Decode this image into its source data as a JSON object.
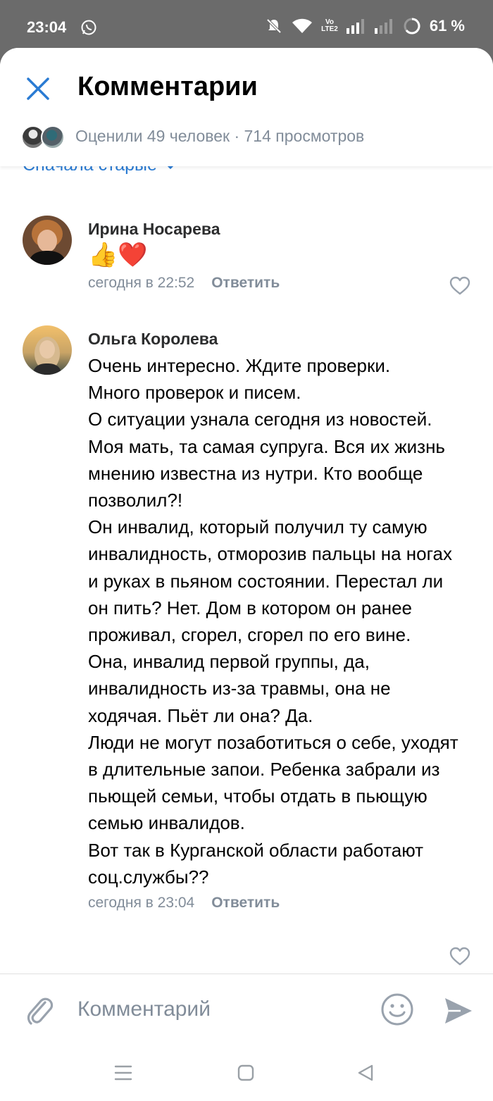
{
  "status_bar": {
    "time": "23:04",
    "battery": "61 %",
    "lte_top": "Vo",
    "lte_bottom": "LTE2"
  },
  "header": {
    "title": "Комментарии",
    "stats": "Оценили 49 человек · 714 просмотров"
  },
  "sort": {
    "label": "Сначала старые"
  },
  "comments": [
    {
      "author": "Ирина Носарева",
      "text": "👍❤️",
      "date": "сегодня в 22:52",
      "reply_label": "Ответить"
    },
    {
      "author": "Ольга Королева",
      "text": "Очень интересно. Ждите проверки.\nМного проверок и писем.\nО ситуации узнала сегодня из новостей.\nМоя мать, та самая супруга. Вся их жизнь мнению известна из нутри. Кто вообще позволил?!\nОн инвалид, который получил ту самую инвалидность, отморозив пальцы на ногах и руках в пьяном состоянии. Перестал ли он пить? Нет. Дом в котором он ранее проживал, сгорел, сгорел по его вине.\nОна, инвалид первой группы, да, инвалидность из-за травмы, она не ходячая. Пьёт ли она? Да.\nЛюди не могут позаботиться о себе, уходят в длительные запои. Ребенка забрали из пьющей семьи, чтобы отдать в пьющую семью инвалидов.\nВот так в Курганской области работают соц.службы??",
      "date": "сегодня в 23:04",
      "reply_label": "Ответить"
    }
  ],
  "composer": {
    "placeholder": "Комментарий"
  },
  "colors": {
    "accent": "#2a7bd3",
    "secondary_text": "#818c99",
    "heart": "#e0213b"
  },
  "icons": [
    "close-icon",
    "paperclip-icon",
    "smile-icon",
    "send-icon",
    "heart-outline-icon",
    "whatsapp-icon",
    "mute-icon",
    "wifi-icon",
    "signal-icon",
    "battery-icon",
    "recents-icon",
    "home-icon",
    "back-icon",
    "chevron-down-icon"
  ]
}
